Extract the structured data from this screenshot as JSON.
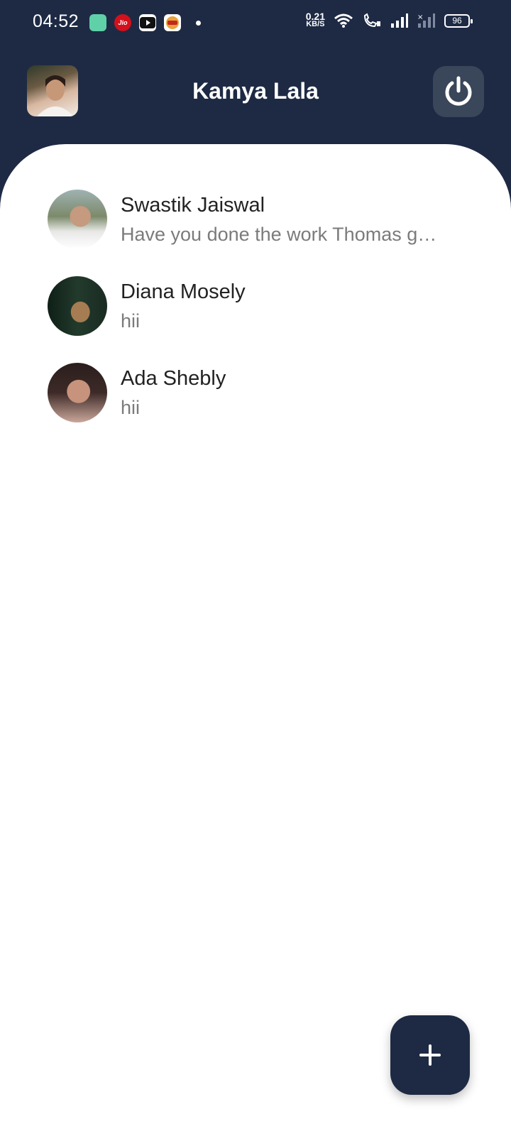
{
  "status_bar": {
    "time": "04:52",
    "notifications": [
      "app-icon",
      "jio-icon",
      "youtube-icon",
      "game-icon"
    ],
    "jio_label": "Jio",
    "net_speed_value": "0.21",
    "net_speed_unit": "KB/S",
    "battery": "96"
  },
  "header": {
    "title": "Kamya Lala",
    "avatar_icon": "profile-photo",
    "power_icon": "power-icon"
  },
  "chats": [
    {
      "name": "Swastik Jaiswal",
      "preview": "Have you done the work Thomas g…"
    },
    {
      "name": "Diana Mosely",
      "preview": "hii"
    },
    {
      "name": "Ada Shebly",
      "preview": "hii"
    }
  ],
  "fab": {
    "icon": "plus-icon"
  },
  "colors": {
    "primary": "#1e2a44",
    "power_button_bg": "#3a4659",
    "panel": "#ffffff",
    "name_text": "#222222",
    "preview_text": "#7b7b7b"
  }
}
